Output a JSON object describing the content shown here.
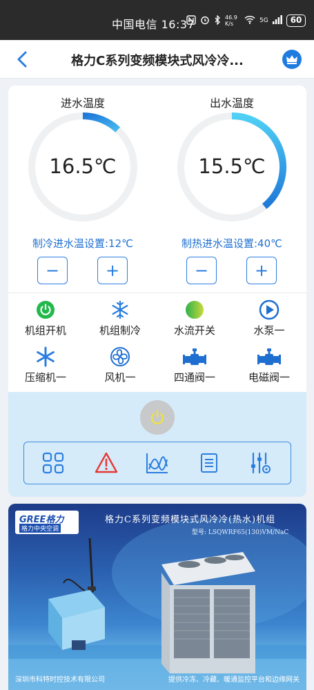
{
  "status_bar": {
    "clock": "中国电信 16:37",
    "net_speed": "46.9 K/s",
    "signal": "5G",
    "battery": "60"
  },
  "header": {
    "title": "格力C系列变频模块式风冷冷..."
  },
  "inlet": {
    "label": "进水温度",
    "value": "16.5℃",
    "setting": "制冷进水温设置:12℃",
    "arc_level": 0.12
  },
  "outlet": {
    "label": "出水温度",
    "value": "15.5℃",
    "setting": "制热进水温设置:40℃",
    "arc_level": 0.39
  },
  "stepper": {
    "minus": "−",
    "plus": "+"
  },
  "status_items": [
    {
      "label": "机组开机",
      "icon": "power-on-icon"
    },
    {
      "label": "机组制冷",
      "icon": "snowflake-icon"
    },
    {
      "label": "水流开关",
      "icon": "water-flow-icon"
    },
    {
      "label": "水泵一",
      "icon": "pump-play-icon"
    },
    {
      "label": "压缩机一",
      "icon": "compressor-snowflake-icon"
    },
    {
      "label": "风机一",
      "icon": "fan-icon"
    },
    {
      "label": "四通阀一",
      "icon": "four-way-valve-icon"
    },
    {
      "label": "电磁阀一",
      "icon": "solenoid-valve-icon"
    }
  ],
  "functions": [
    {
      "name": "grid-icon"
    },
    {
      "name": "alarm-icon"
    },
    {
      "name": "chart-icon"
    },
    {
      "name": "list-icon"
    },
    {
      "name": "settings-sliders-icon"
    }
  ],
  "banner": {
    "brand": "GREE格力",
    "brand_sub": "格力中央空调",
    "title": "格力C系列变频模块式风冷冷(热水)机组",
    "model": "型号: LSQWRF65(130)VM/NaC",
    "footer_left": "深圳市科特时控技术有限公司",
    "footer_right": "提供冷冻、冷藏、暖通监控平台和边缘网关"
  },
  "colors": {
    "accent": "#2a7de0",
    "ring_track": "#eef0f2",
    "status_green": "#22b84a",
    "alarm_red": "#e53935",
    "panel_blue": "#d6ebf9"
  }
}
